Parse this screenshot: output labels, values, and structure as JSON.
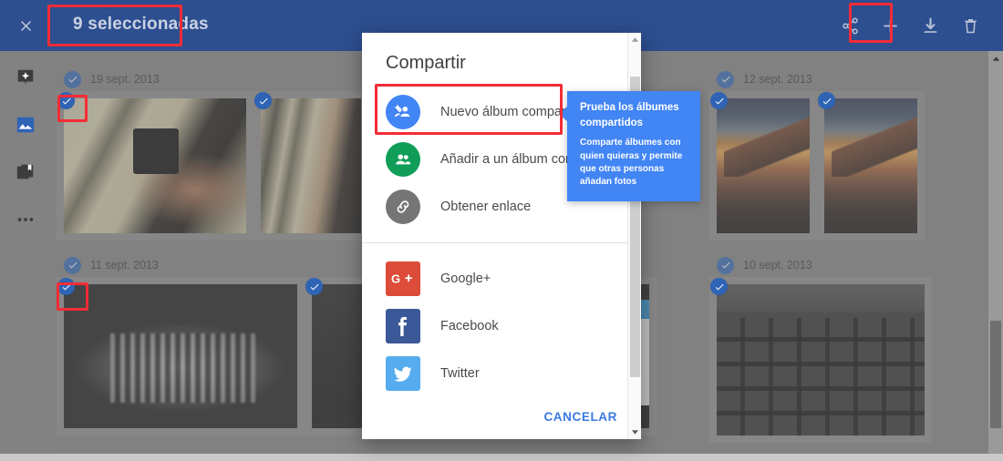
{
  "topbar": {
    "close_icon": "close-icon",
    "selection_label": "9 seleccionadas",
    "actions": [
      {
        "name": "share-icon",
        "label": "Compartir",
        "highlighted": true
      },
      {
        "name": "add-icon",
        "label": "Añadir a"
      },
      {
        "name": "download-icon",
        "label": "Descargar"
      },
      {
        "name": "delete-icon",
        "label": "Eliminar"
      }
    ],
    "bg_color": "#2d4e8f",
    "highlight_color": "#f42c36"
  },
  "sidebar": {
    "items": [
      {
        "name": "assistant-icon",
        "label": "Asistente",
        "active": false
      },
      {
        "name": "photos-icon",
        "label": "Fotos",
        "active": true
      },
      {
        "name": "albums-icon",
        "label": "Álbumes",
        "active": false
      },
      {
        "name": "more-icon",
        "label": "Más",
        "active": false
      }
    ],
    "active_color": "#2f64b5"
  },
  "grid": {
    "days": [
      {
        "date": "19 sept. 2013",
        "selected": true,
        "photos": 2
      },
      {
        "date": "12 sept. 2013",
        "selected": true,
        "photos": 2
      },
      {
        "date": "11 sept. 2013",
        "selected": true,
        "photos": 3
      },
      {
        "date": "10 sept. 2013",
        "selected": true,
        "photos": 1
      }
    ],
    "check_color": "#2f64b5"
  },
  "dialog": {
    "title": "Compartir",
    "options": [
      {
        "label": "Nuevo álbum compartido",
        "icon": "add-group-icon",
        "color": "#4285f4",
        "highlighted": true
      },
      {
        "label": "Añadir a un álbum compartido",
        "icon": "group-icon",
        "color": "#0f9d58",
        "highlighted": false
      },
      {
        "label": "Obtener enlace",
        "icon": "link-icon",
        "color": "#757575",
        "highlighted": false
      }
    ],
    "social": [
      {
        "label": "Google+",
        "icon": "google-plus-icon",
        "color": "#dd4b39"
      },
      {
        "label": "Facebook",
        "icon": "facebook-icon",
        "color": "#3b5998"
      },
      {
        "label": "Twitter",
        "icon": "twitter-icon",
        "color": "#55acee"
      }
    ],
    "cancel_label": "CANCELAR"
  },
  "tooltip": {
    "title": "Prueba los álbumes compartidos",
    "body": "Comparte álbumes con quien quieras y permite que otras personas añadan fotos",
    "color": "#4285f4"
  }
}
